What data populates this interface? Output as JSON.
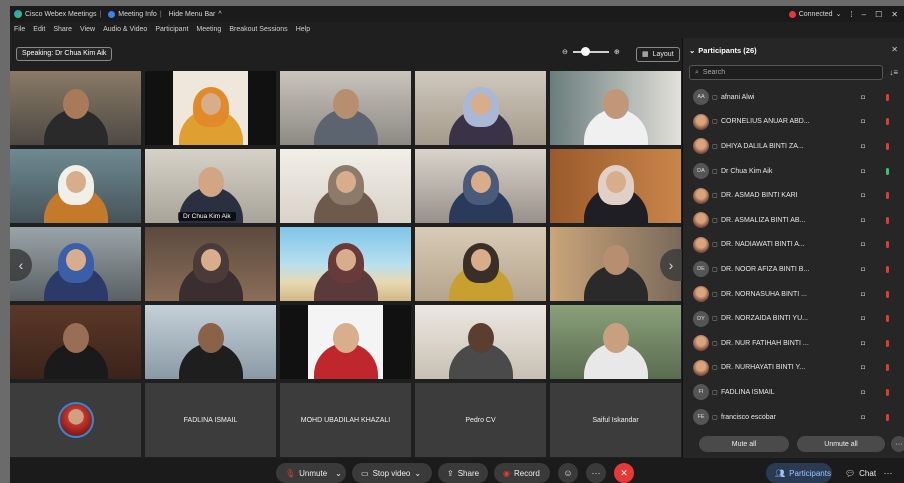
{
  "titlebar": {
    "app_name": "Cisco Webex Meetings",
    "meeting_info": "Meeting Info",
    "hide_menu": "Hide Menu Bar",
    "status": "Connected",
    "win_min": "–",
    "win_max": "☐",
    "win_close": "✕"
  },
  "menu": [
    "File",
    "Edit",
    "Share",
    "View",
    "Audio & Video",
    "Participant",
    "Meeting",
    "Breakout Sessions",
    "Help"
  ],
  "speaking": "Speaking: Dr Chua Kim Aik",
  "layout_label": "Layout",
  "active_tile_name": "Dr Chua Kim Aik",
  "name_tiles": [
    "FADLINA ISMAIL",
    "MOHD UBADILAH KHAZALI",
    "Pedro CV",
    "Saiful Iskandar"
  ],
  "controls": {
    "unmute": "Unmute",
    "stop_video": "Stop video",
    "share": "Share",
    "record": "Record",
    "participants": "Participants",
    "chat": "Chat"
  },
  "panel": {
    "title": "Participants (26)",
    "search_placeholder": "Search",
    "mute_all": "Mute all",
    "unmute_all": "Unmute all"
  },
  "participants": [
    {
      "initials": "AA",
      "name": "afnani Alwi",
      "photo": false,
      "mic_on": false
    },
    {
      "initials": "",
      "name": "CORNELIUS ANUAR ABD...",
      "photo": true,
      "mic_on": false
    },
    {
      "initials": "",
      "name": "DHIYA DALILA BINTI ZA...",
      "photo": true,
      "mic_on": false
    },
    {
      "initials": "DA",
      "name": "Dr Chua Kim Aik",
      "photo": false,
      "mic_on": true
    },
    {
      "initials": "",
      "name": "DR. ASMAD BINTI KARI",
      "photo": true,
      "mic_on": false
    },
    {
      "initials": "",
      "name": "DR. ASMALIZA BINTI AB...",
      "photo": true,
      "mic_on": false
    },
    {
      "initials": "",
      "name": "DR. NADIAWATI BINTI A...",
      "photo": true,
      "mic_on": false
    },
    {
      "initials": "DE",
      "name": "DR. NOOR AFIZA BINTI B...",
      "photo": false,
      "mic_on": false
    },
    {
      "initials": "",
      "name": "DR. NORNASUHA BINTI ...",
      "photo": true,
      "mic_on": false
    },
    {
      "initials": "DY",
      "name": "DR. NORZAIDA BINTI YU...",
      "photo": false,
      "mic_on": false
    },
    {
      "initials": "",
      "name": "DR. NUR FATIHAH BINTI ...",
      "photo": true,
      "mic_on": false
    },
    {
      "initials": "",
      "name": "DR. NURHAYATI BINTI Y...",
      "photo": true,
      "mic_on": false
    },
    {
      "initials": "FI",
      "name": "FADLINA ISMAIL",
      "photo": false,
      "mic_on": false
    },
    {
      "initials": "FE",
      "name": "francisco escobar",
      "photo": false,
      "mic_on": false
    }
  ]
}
